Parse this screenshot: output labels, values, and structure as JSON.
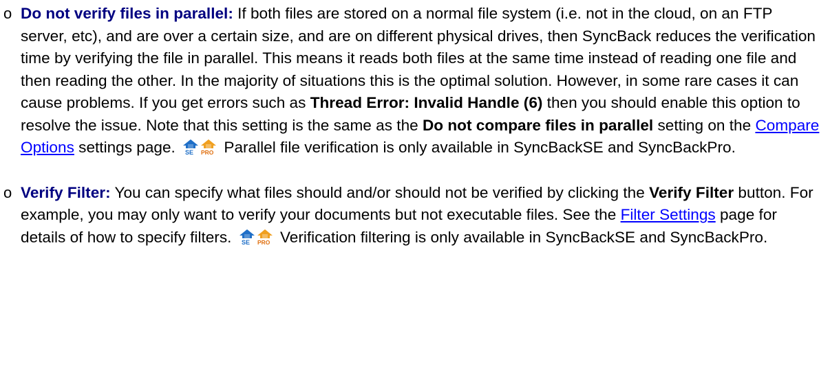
{
  "colors": {
    "term": "#000080",
    "link": "#0000ff",
    "se_badge": "#1f6fc7",
    "pro_badge": "#f0a020"
  },
  "icons": [
    "se-edition-icon",
    "pro-edition-icon"
  ],
  "items": [
    {
      "marker": "o",
      "term": "Do not verify files in parallel:",
      "text_1": " If both files are stored on a normal file system (i.e. not in the cloud, on an FTP server, etc), and are over a certain size, and are on different physical drives, then SyncBack reduces the verification time by verifying the file in parallel. This means it reads both files at the same time instead of reading one file and then reading the other. In the majority of situations this is the optimal solution. However, in some rare cases it can cause problems. If you get errors such as ",
      "bold_1": "Thread Error: Invalid Handle (6)",
      "text_2": " then you should enable this option to resolve the issue. Note that this setting is the same as the ",
      "bold_2": "Do not compare files in parallel",
      "text_3": " setting on the ",
      "link": "Compare Options",
      "text_4": " settings page. ",
      "text_5": " Parallel file verification is only available in SyncBackSE and SyncBackPro."
    },
    {
      "marker": "o",
      "term": "Verify Filter:",
      "text_1": " You can specify what files should and/or should not be verified by clicking the ",
      "bold_1": "Verify Filter",
      "text_2": " button. For example, you may only want to verify your documents but not executable files. See the ",
      "link": "Filter Settings",
      "text_3": " page for details of how to specify filters. ",
      "text_4": " Verification filtering is only available in SyncBackSE and SyncBackPro."
    }
  ]
}
